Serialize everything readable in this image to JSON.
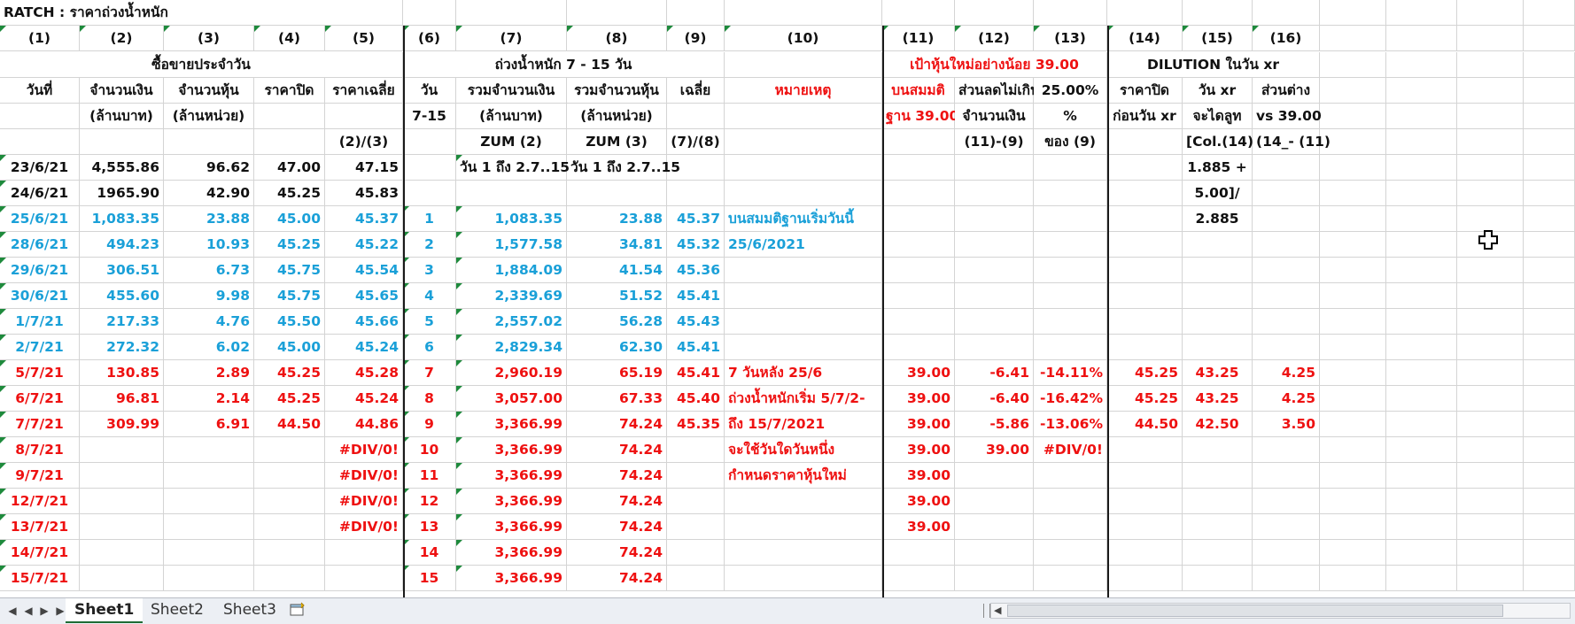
{
  "app": {
    "sheet_title": "RATCH  : ราคาถ่วงน้ำหนัก",
    "tabs": [
      "Sheet1",
      "Sheet2",
      "Sheet3"
    ],
    "active_tab": "Sheet1"
  },
  "colors": {
    "black": "#111111",
    "blue": "#1aa0d8",
    "red": "#ee1111",
    "green_marker": "#1e8a3c"
  },
  "headers": {
    "col_numbers": [
      "(1)",
      "(2)",
      "(3)",
      "(4)",
      "(5)",
      "(6)",
      "(7)",
      "(8)",
      "(9)",
      "(10)",
      "(11)",
      "(12)",
      "(13)",
      "(14)",
      "(15)",
      "(16)"
    ],
    "group_daily": "ซื้อขายประจำวัน",
    "group_weighted": "ถ่วงน้ำหนัก 7 - 15 วัน",
    "group_target": "เป้าหุ้นใหม่อย่างน้อย 39.00",
    "group_dilution": "DILUTION ในวัน xr",
    "row1": [
      "วันที่",
      "จำนวนเงิน",
      "จำนวนหุ้น",
      "ราคาปิด",
      "ราคาเฉลี่ย",
      "วัน",
      "รวมจำนวนเงิน",
      "รวมจำนวนหุ้น",
      "เฉลี่ย",
      "หมายเหตุ",
      "บนสมมติ",
      "ส่วนลดไม่เกิน",
      "25.00%",
      "ราคาปิด",
      "วัน xr",
      "ส่วนต่าง"
    ],
    "row2": [
      "",
      "(ล้านบาท)",
      "(ล้านหน่วย)",
      "",
      "",
      "7-15",
      "(ล้านบาท)",
      "(ล้านหน่วย)",
      "",
      "",
      "ฐาน 39.00",
      "จำนวนเงิน",
      "%",
      "ก่อนวัน xr",
      "จะไดลูท",
      "vs 39.00"
    ],
    "row3": [
      "",
      "",
      "",
      "",
      "(2)/(3)",
      "",
      "ZUM (2)",
      "ZUM (3)",
      "(7)/(8)",
      "",
      "",
      "(11)-(9)",
      "ของ (9)",
      "",
      "[Col.(14)*",
      "(14_- (11)"
    ]
  },
  "rows": [
    {
      "color": "k",
      "date": "23/6/21",
      "amount": "4,555.86",
      "shares": "96.62",
      "close": "47.00",
      "avg": "47.15",
      "day": "",
      "sum_amt": "วัน 1 ถึง 2.7..15",
      "sum_sh": "วัน 1 ถึง 2.7..15",
      "wavg": "",
      "note": "",
      "base": "",
      "diff": "",
      "pct": "",
      "pclose": "",
      "xr": "1.885 +",
      "vs": ""
    },
    {
      "color": "k",
      "date": "24/6/21",
      "amount": "1965.90",
      "shares": "42.90",
      "close": "45.25",
      "avg": "45.83",
      "day": "",
      "sum_amt": "",
      "sum_sh": "",
      "wavg": "",
      "note": "",
      "base": "",
      "diff": "",
      "pct": "",
      "pclose": "",
      "xr": "5.00]/",
      "vs": ""
    },
    {
      "color": "b",
      "date": "25/6/21",
      "amount": "1,083.35",
      "shares": "23.88",
      "close": "45.00",
      "avg": "45.37",
      "day": "1",
      "sum_amt": "1,083.35",
      "sum_sh": "23.88",
      "wavg": "45.37",
      "note": "บนสมมติฐานเริ่มวันนี้",
      "base": "",
      "diff": "",
      "pct": "",
      "pclose": "",
      "xr": "2.885",
      "vs": ""
    },
    {
      "color": "b",
      "date": "28/6/21",
      "amount": "494.23",
      "shares": "10.93",
      "close": "45.25",
      "avg": "45.22",
      "day": "2",
      "sum_amt": "1,577.58",
      "sum_sh": "34.81",
      "wavg": "45.32",
      "note": "25/6/2021",
      "base": "",
      "diff": "",
      "pct": "",
      "pclose": "",
      "xr": "",
      "vs": ""
    },
    {
      "color": "b",
      "date": "29/6/21",
      "amount": "306.51",
      "shares": "6.73",
      "close": "45.75",
      "avg": "45.54",
      "day": "3",
      "sum_amt": "1,884.09",
      "sum_sh": "41.54",
      "wavg": "45.36",
      "note": "",
      "base": "",
      "diff": "",
      "pct": "",
      "pclose": "",
      "xr": "",
      "vs": ""
    },
    {
      "color": "b",
      "date": "30/6/21",
      "amount": "455.60",
      "shares": "9.98",
      "close": "45.75",
      "avg": "45.65",
      "day": "4",
      "sum_amt": "2,339.69",
      "sum_sh": "51.52",
      "wavg": "45.41",
      "note": "",
      "base": "",
      "diff": "",
      "pct": "",
      "pclose": "",
      "xr": "",
      "vs": ""
    },
    {
      "color": "b",
      "date": "1/7/21",
      "amount": "217.33",
      "shares": "4.76",
      "close": "45.50",
      "avg": "45.66",
      "day": "5",
      "sum_amt": "2,557.02",
      "sum_sh": "56.28",
      "wavg": "45.43",
      "note": "",
      "base": "",
      "diff": "",
      "pct": "",
      "pclose": "",
      "xr": "",
      "vs": ""
    },
    {
      "color": "b",
      "date": "2/7/21",
      "amount": "272.32",
      "shares": "6.02",
      "close": "45.00",
      "avg": "45.24",
      "day": "6",
      "sum_amt": "2,829.34",
      "sum_sh": "62.30",
      "wavg": "45.41",
      "note": "",
      "base": "",
      "diff": "",
      "pct": "",
      "pclose": "",
      "xr": "",
      "vs": ""
    },
    {
      "color": "rd",
      "date": "5/7/21",
      "amount": "130.85",
      "shares": "2.89",
      "close": "45.25",
      "avg": "45.28",
      "day": "7",
      "sum_amt": "2,960.19",
      "sum_sh": "65.19",
      "wavg": "45.41",
      "note": "7  วันหลัง 25/6",
      "base": "39.00",
      "diff": "-6.41",
      "pct": "-14.11%",
      "pclose": "45.25",
      "xr": "43.25",
      "vs": "4.25"
    },
    {
      "color": "rd",
      "date": "6/7/21",
      "amount": "96.81",
      "shares": "2.14",
      "close": "45.25",
      "avg": "45.24",
      "day": "8",
      "sum_amt": "3,057.00",
      "sum_sh": "67.33",
      "wavg": "45.40",
      "note": "ถ่วงน้ำหนักเริ่ม 5/7/2-",
      "base": "39.00",
      "diff": "-6.40",
      "pct": "-16.42%",
      "pclose": "45.25",
      "xr": "43.25",
      "vs": "4.25"
    },
    {
      "color": "rd",
      "date": "7/7/21",
      "amount": "309.99",
      "shares": "6.91",
      "close": "44.50",
      "avg": "44.86",
      "day": "9",
      "sum_amt": "3,366.99",
      "sum_sh": "74.24",
      "wavg": "45.35",
      "note": "ถึง 15/7/2021",
      "base": "39.00",
      "diff": "-5.86",
      "pct": "-13.06%",
      "pclose": "44.50",
      "xr": "42.50",
      "vs": "3.50"
    },
    {
      "color": "rd",
      "date": "8/7/21",
      "amount": "",
      "shares": "",
      "close": "",
      "avg": "#DIV/0!",
      "day": "10",
      "sum_amt": "3,366.99",
      "sum_sh": "74.24",
      "wavg": "",
      "note": "จะใช้วันใดวันหนึ่ง",
      "base": "39.00",
      "diff": "39.00",
      "pct": "#DIV/0!",
      "pclose": "",
      "xr": "",
      "vs": ""
    },
    {
      "color": "rd",
      "date": "9/7/21",
      "amount": "",
      "shares": "",
      "close": "",
      "avg": "#DIV/0!",
      "day": "11",
      "sum_amt": "3,366.99",
      "sum_sh": "74.24",
      "wavg": "",
      "note": "กำหนดราคาหุ้นใหม่",
      "base": "39.00",
      "diff": "",
      "pct": "",
      "pclose": "",
      "xr": "",
      "vs": ""
    },
    {
      "color": "rd",
      "date": "12/7/21",
      "amount": "",
      "shares": "",
      "close": "",
      "avg": "#DIV/0!",
      "day": "12",
      "sum_amt": "3,366.99",
      "sum_sh": "74.24",
      "wavg": "",
      "note": "",
      "base": "39.00",
      "diff": "",
      "pct": "",
      "pclose": "",
      "xr": "",
      "vs": ""
    },
    {
      "color": "rd",
      "date": "13/7/21",
      "amount": "",
      "shares": "",
      "close": "",
      "avg": "#DIV/0!",
      "day": "13",
      "sum_amt": "3,366.99",
      "sum_sh": "74.24",
      "wavg": "",
      "note": "",
      "base": "39.00",
      "diff": "",
      "pct": "",
      "pclose": "",
      "xr": "",
      "vs": ""
    },
    {
      "color": "rd",
      "date": "14/7/21",
      "amount": "",
      "shares": "",
      "close": "",
      "avg": "",
      "day": "14",
      "sum_amt": "3,366.99",
      "sum_sh": "74.24",
      "wavg": "",
      "note": "",
      "base": "",
      "diff": "",
      "pct": "",
      "pclose": "",
      "xr": "",
      "vs": ""
    },
    {
      "color": "rd",
      "date": "15/7/21",
      "amount": "",
      "shares": "",
      "close": "",
      "avg": "",
      "day": "15",
      "sum_amt": "3,366.99",
      "sum_sh": "74.24",
      "wavg": "",
      "note": "",
      "base": "",
      "diff": "",
      "pct": "",
      "pclose": "",
      "xr": "",
      "vs": ""
    }
  ]
}
